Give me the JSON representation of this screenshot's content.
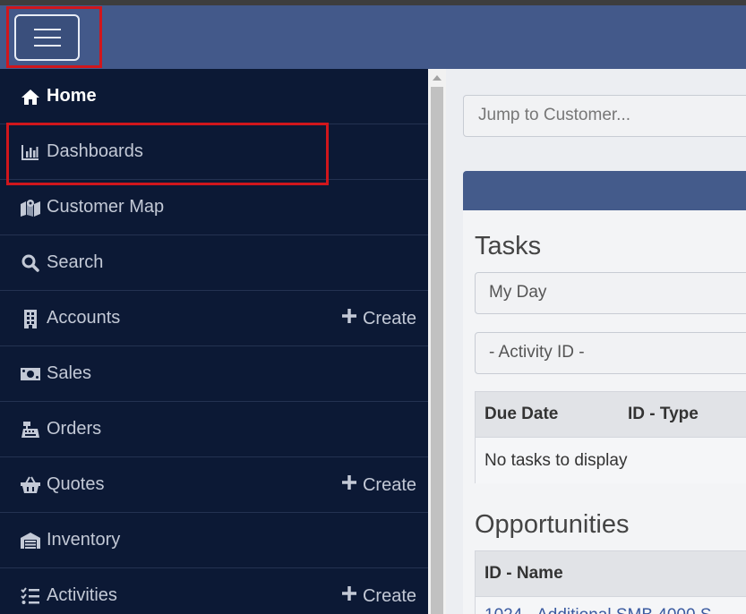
{
  "nav": {
    "menu_button": "hamburger-menu"
  },
  "sidebar": {
    "items": [
      {
        "label": "Home",
        "icon": "home-icon"
      },
      {
        "label": "Dashboards",
        "icon": "bar-chart-icon"
      },
      {
        "label": "Customer Map",
        "icon": "map-icon"
      },
      {
        "label": "Search",
        "icon": "search-icon"
      },
      {
        "label": "Accounts",
        "icon": "building-icon",
        "create": "Create"
      },
      {
        "label": "Sales",
        "icon": "money-icon"
      },
      {
        "label": "Orders",
        "icon": "cash-register-icon"
      },
      {
        "label": "Quotes",
        "icon": "basket-icon",
        "create": "Create"
      },
      {
        "label": "Inventory",
        "icon": "warehouse-icon"
      },
      {
        "label": "Activities",
        "icon": "task-list-icon",
        "create": "Create"
      }
    ]
  },
  "main": {
    "jump_placeholder": "Jump to Customer...",
    "tasks": {
      "title": "Tasks",
      "filter1": "My Day",
      "filter2": "- Activity ID -",
      "columns": [
        "Due Date",
        "ID - Type"
      ],
      "empty": "No tasks to display"
    },
    "opportunities": {
      "title": "Opportunities",
      "columns": [
        "ID - Name"
      ],
      "first_row": "1024 - Additional SMB 4000 S"
    }
  },
  "colors": {
    "navbar": "#43598a",
    "sidebar": "#0c1935",
    "highlight": "#d0161c"
  }
}
